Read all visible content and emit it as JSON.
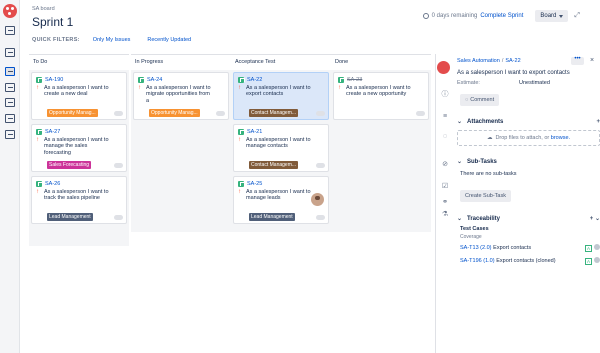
{
  "header": {
    "breadcrumb": "SA board",
    "title": "Sprint 1"
  },
  "quick_filters": {
    "label": "QUICK FILTERS:",
    "items": [
      "Only My Issues",
      "Recently Updated"
    ]
  },
  "top_right": {
    "remaining": "0 days remaining",
    "complete": "Complete Sprint",
    "board_btn": "Board"
  },
  "columns": [
    {
      "name": "To Do",
      "cards": [
        {
          "key": "SA-190",
          "summary": "As a salesperson I want to create a new deal",
          "epic": "Opportunity Manag...",
          "epic_color": "#f79232"
        },
        {
          "key": "SA-27",
          "summary": "As a salesperson I want to manage the sales forecasting",
          "epic": "Sales Forecasting",
          "epic_color": "#cc3399"
        },
        {
          "key": "SA-26",
          "summary": "As a salesperson I want to track the sales pipeline",
          "epic": "Lead Management",
          "epic_color": "#505f79"
        }
      ]
    },
    {
      "name": "In Progress",
      "cards": [
        {
          "key": "SA-24",
          "summary": "As a salesperson I want to migrate opportunities from a",
          "epic": "Opportunity Manag...",
          "epic_color": "#f79232"
        }
      ]
    },
    {
      "name": "Acceptance Test",
      "cards": [
        {
          "key": "SA-22",
          "summary": "As a salesperson I want to export contacts",
          "epic": "Contact Managem...",
          "epic_color": "#815b3a"
        },
        {
          "key": "SA-21",
          "summary": "As a salesperson I want to manage contacts",
          "epic": "Contact Managem...",
          "epic_color": "#815b3a"
        },
        {
          "key": "SA-25",
          "summary": "As a salesperson I want to manage leads",
          "epic": "Lead Management",
          "epic_color": "#505f79"
        }
      ]
    },
    {
      "name": "Done",
      "cards": [
        {
          "key": "SA-23",
          "summary": "As a salesperson I want to create a new opportunity",
          "epic": "",
          "epic_color": ""
        }
      ]
    }
  ],
  "detail": {
    "project": "Sales Automation",
    "key": "SA-22",
    "summary": "As a salesperson I want to export contacts",
    "estimate_label": "Estimate:",
    "estimate_value": "Unestimated",
    "comment_btn": "Comment",
    "attachments_title": "Attachments",
    "drop_text": "Drop files to attach, or",
    "browse": "browse.",
    "subtasks_title": "Sub-Tasks",
    "no_subtasks": "There are no sub-tasks",
    "create_subtask": "Create Sub-Task",
    "traceability_title": "Traceability",
    "test_cases": "Test Cases",
    "coverage": "Coverage",
    "tests": [
      {
        "link": "SA-T13 (2.0)",
        "name": "Export contacts",
        "badge": "A"
      },
      {
        "link": "SA-T196 (1.0)",
        "name": "Export contacts (cloned)",
        "badge": "A"
      }
    ]
  }
}
